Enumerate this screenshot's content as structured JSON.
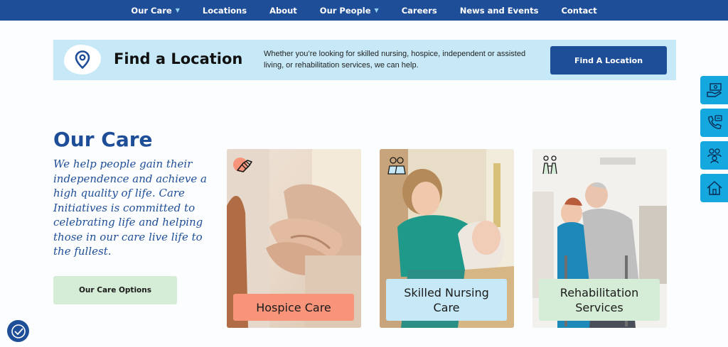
{
  "nav": {
    "items": [
      {
        "label": "Our Care",
        "dropdown": true
      },
      {
        "label": "Locations",
        "dropdown": false
      },
      {
        "label": "About",
        "dropdown": false
      },
      {
        "label": "Our People",
        "dropdown": true
      },
      {
        "label": "Careers",
        "dropdown": false
      },
      {
        "label": "News and Events",
        "dropdown": false
      },
      {
        "label": "Contact",
        "dropdown": false
      }
    ],
    "bg_color": "#1f4e99"
  },
  "find_location": {
    "title": "Find a Location",
    "description": "Whether you’re looking for skilled nursing, hospice, independent or assisted living, or rehabilitation services, we can help.",
    "button_label": "Find A Location",
    "icon": "map-pin-icon"
  },
  "our_care": {
    "heading": "Our Care",
    "description": "We help people gain their independence and achieve a high quality of life. Care Initiatives is committed to celebrating life and helping those in our care live life to the fullest.",
    "button_label": "Our Care Options"
  },
  "cards": [
    {
      "label": "Hospice Care",
      "icon": "holding-hands-icon",
      "label_color": "#f7947a"
    },
    {
      "label": "Skilled Nursing Care",
      "icon": "nurses-icon",
      "label_color": "#c7e9f7"
    },
    {
      "label": "Rehabilitation Services",
      "icon": "walking-assist-icon",
      "label_color": "#d5ecd6"
    }
  ],
  "side_buttons": [
    {
      "icon": "donate-hand-icon"
    },
    {
      "icon": "phone-chat-icon"
    },
    {
      "icon": "people-group-icon"
    },
    {
      "icon": "home-icon"
    }
  ],
  "accessibility": {
    "icon": "accessibility-icon"
  },
  "colors": {
    "brand_blue": "#1f4e99",
    "light_blue": "#c7e9f7",
    "accent_cyan": "#14a8df",
    "light_green": "#d5ecd6",
    "salmon": "#f7947a"
  }
}
